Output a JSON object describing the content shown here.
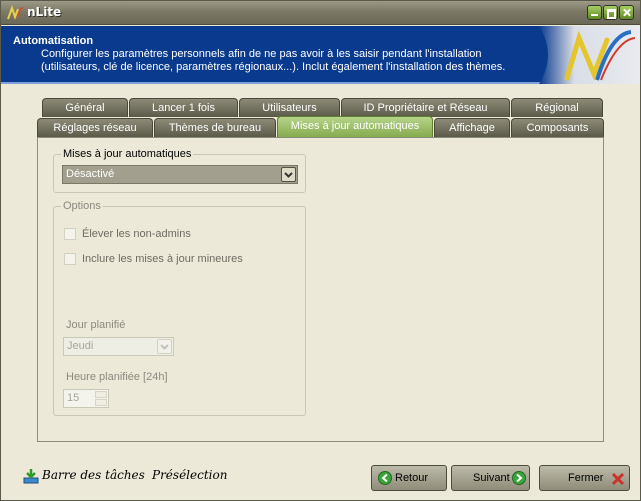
{
  "window": {
    "title": "nLite"
  },
  "header": {
    "title": "Automatisation",
    "description_line1": "Configurer les paramètres personnels afin de ne pas avoir à les saisir pendant l'installation",
    "description_line2": "(utilisateurs, clé de licence, paramètres régionaux...). Inclut également l'installation des thèmes."
  },
  "tabs_row1": [
    "Général",
    "Lancer 1 fois",
    "Utilisateurs",
    "ID Propriétaire et Réseau",
    "Régional"
  ],
  "tabs_row2": [
    "Réglages réseau",
    "Thèmes de bureau",
    "Mises à jour automatiques",
    "Affichage",
    "Composants"
  ],
  "auto_updates": {
    "group_label": "Mises à jour automatiques",
    "selected_value": "Désactivé"
  },
  "options": {
    "group_label": "Options",
    "elevate_label": "Élever les non-admins",
    "minor_label": "Inclure les mises à jour mineures",
    "day_label": "Jour planifié",
    "day_value": "Jeudi",
    "time_label": "Heure planifiée [24h]",
    "time_value": "15"
  },
  "footer": {
    "taskbar_label": "Barre des tâches",
    "preset_label": "Présélection",
    "back_label": "Retour",
    "next_label": "Suivant",
    "close_label": "Fermer"
  }
}
